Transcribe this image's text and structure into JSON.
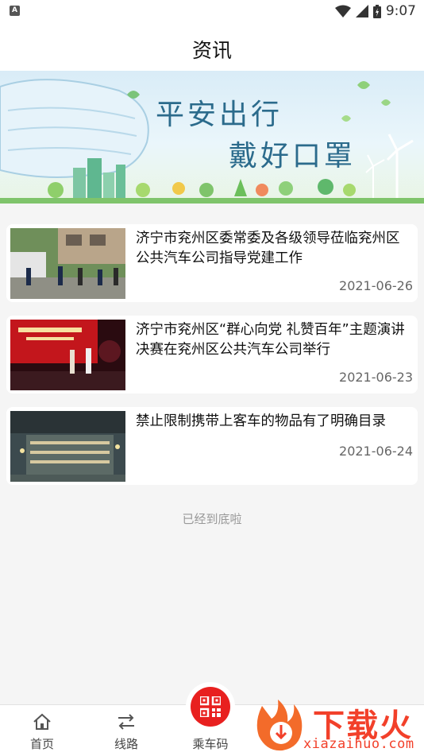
{
  "status_bar": {
    "left_badge": "A",
    "time": "9:07"
  },
  "header": {
    "title": "资讯"
  },
  "banner": {
    "line1": "平安出行",
    "line2": "戴好口罩"
  },
  "news": [
    {
      "title": "济宁市兖州区委常委及各级领导莅临兖州区公共汽车公司指导党建工作",
      "date": "2021-06-26"
    },
    {
      "title": "济宁市兖州区“群心向党 礼赞百年”主题演讲决赛在兖州区公共汽车公司举行",
      "date": "2021-06-23"
    },
    {
      "title": "禁止限制携带上客车的物品有了明确目录",
      "date": "2021-06-24"
    }
  ],
  "end_text": "已经到底啦",
  "tabs": {
    "home": "首页",
    "routes": "线路",
    "ride_code": "乘车码"
  },
  "watermark": {
    "brand": "下载火",
    "url": "xiazaihuo.com"
  },
  "colors": {
    "accent": "#e8201f",
    "logo": "#f2402a",
    "banner_text": "#2b6b8c"
  }
}
